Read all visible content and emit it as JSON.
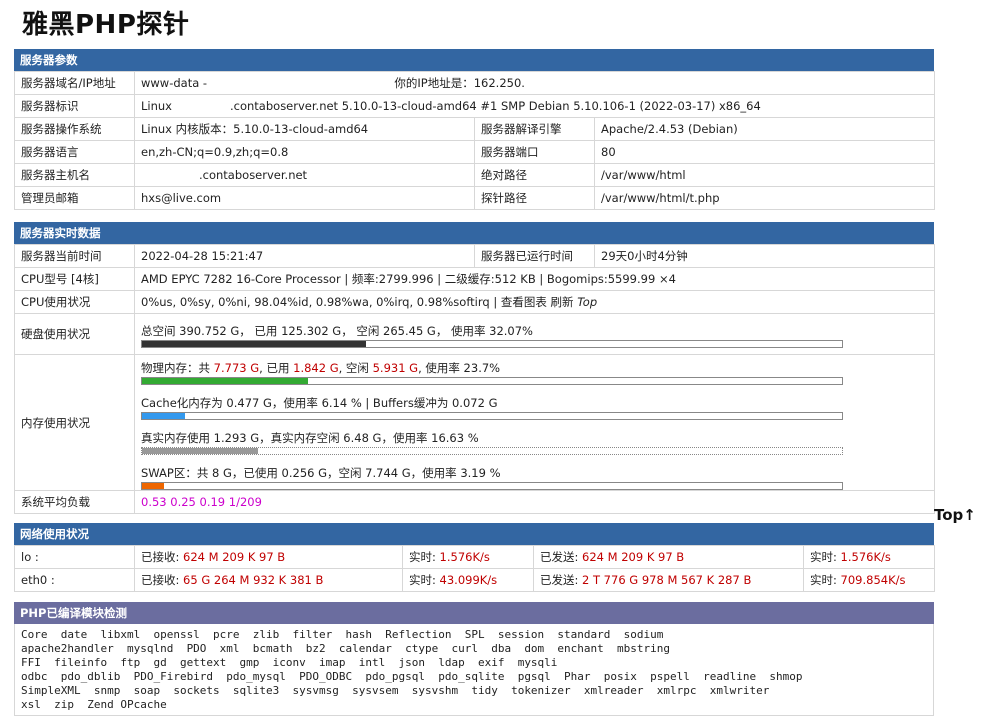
{
  "page_title": "雅黑PHP探针",
  "server_params": {
    "header": "服务器参数",
    "domain_label": "服务器域名/IP地址",
    "domain_value": "www-data -",
    "your_ip": "你的IP地址是：162.250.",
    "ident_label": "服务器标识",
    "ident_prefix": "Linux",
    "ident_value": ".contaboserver.net 5.10.0-13-cloud-amd64 #1 SMP Debian 5.10.106-1 (2022-03-17) x86_64",
    "os_label": "服务器操作系统",
    "os_value": "Linux  内核版本：5.10.0-13-cloud-amd64",
    "engine_label": "服务器解译引擎",
    "engine_value": "Apache/2.4.53 (Debian)",
    "lang_label": "服务器语言",
    "lang_value": "en,zh-CN;q=0.9,zh;q=0.8",
    "port_label": "服务器端口",
    "port_value": "80",
    "host_label": "服务器主机名",
    "host_value": ".contaboserver.net",
    "abs_label": "绝对路径",
    "abs_value": "/var/www/html",
    "admin_label": "管理员邮箱",
    "admin_value": "hxs@live.com",
    "probe_label": "探针路径",
    "probe_value": "/var/www/html/t.php"
  },
  "realtime": {
    "header": "服务器实时数据",
    "time_label": "服务器当前时间",
    "time_value": "2022-04-28 15:21:47",
    "uptime_label": "服务器已运行时间",
    "uptime_value": "29天0小时4分钟",
    "cpu_model_label": "CPU型号 [4核]",
    "cpu_model_value": "AMD EPYC 7282 16-Core Processor | 频率:2799.996 | 二级缓存:512 KB | Bogomips:5599.99 ×4",
    "cpu_usage_label": "CPU使用状况",
    "cpu_usage_value": "0%us, 0%sy, 0%ni, 98.04%id, 0.98%wa, 0%irq, 0.98%softirq | 查看图表  刷新",
    "cpu_top": "Top",
    "disk_label": "硬盘使用状况",
    "disk_value": "总空间 390.752 G， 已用 125.302 G， 空闲 265.45 G， 使用率 32.07%",
    "disk_pct": 32.07,
    "mem_label": "内存使用状况",
    "mem_phys_a": "物理内存：共",
    "mem_phys_total": "7.773 G",
    "mem_phys_b": ", 已用",
    "mem_phys_used": "1.842 G",
    "mem_phys_c": ", 空闲",
    "mem_phys_free": "5.931 G",
    "mem_phys_d": ", 使用率 23.7%",
    "mem_phys_pct": 23.7,
    "mem_cache": "Cache化内存为 0.477 G，使用率 6.14 % | Buffers缓冲为 0.072 G",
    "mem_cache_pct": 6.14,
    "mem_real": "真实内存使用 1.293 G，真实内存空闲 6.48 G，使用率 16.63 %",
    "mem_real_pct": 16.63,
    "mem_swap": "SWAP区：共 8 G，已使用 0.256 G，空闲 7.744 G，使用率 3.19 %",
    "mem_swap_pct": 3.19,
    "load_label": "系统平均负载",
    "load_value": "0.53 0.25 0.19 1/209"
  },
  "top_link": "Top↑",
  "network": {
    "header": "网络使用状况",
    "rows": [
      {
        "iface": "lo :",
        "rx_label": "已接收: ",
        "rx": "624 M 209 K 97 B",
        "rt_label": "实时: ",
        "rt_rx": "1.576K/s",
        "tx_label": "已发送: ",
        "tx": "624 M 209 K 97 B",
        "rt2_label": "实时: ",
        "rt_tx": "1.576K/s"
      },
      {
        "iface": "eth0 :",
        "rx_label": "已接收: ",
        "rx": "65 G 264 M 932 K 381 B",
        "rt_label": "实时: ",
        "rt_rx": "43.099K/s",
        "tx_label": "已发送: ",
        "tx": "2 T 776 G 978 M 567 K 287 B",
        "rt2_label": "实时: ",
        "rt_tx": "709.854K/s"
      }
    ]
  },
  "modules": {
    "header": "PHP已编译模块检测",
    "text": "Core  date  libxml  openssl  pcre  zlib  filter  hash  Reflection  SPL  session  standard  sodium\napache2handler  mysqlnd  PDO  xml  bcmath  bz2  calendar  ctype  curl  dba  dom  enchant  mbstring\nFFI  fileinfo  ftp  gd  gettext  gmp  iconv  imap  intl  json  ldap  exif  mysqli\nodbc  pdo_dblib  PDO_Firebird  pdo_mysql  PDO_ODBC  pdo_pgsql  pdo_sqlite  pgsql  Phar  posix  pspell  readline  shmop\nSimpleXML  snmp  soap  sockets  sqlite3  sysvmsg  sysvsem  sysvshm  tidy  tokenizer  xmlreader  xmlrpc  xmlwriter\nxsl  zip  Zend OPcache"
  },
  "colors": {
    "header_blue": "#3366a2",
    "header_purple": "#6b6d9f",
    "disk_bar": "#333333",
    "mem_bar": "#33aa33",
    "cache_bar": "#3399ee",
    "real_bar": "#999999",
    "swap_bar": "#ee6600"
  }
}
